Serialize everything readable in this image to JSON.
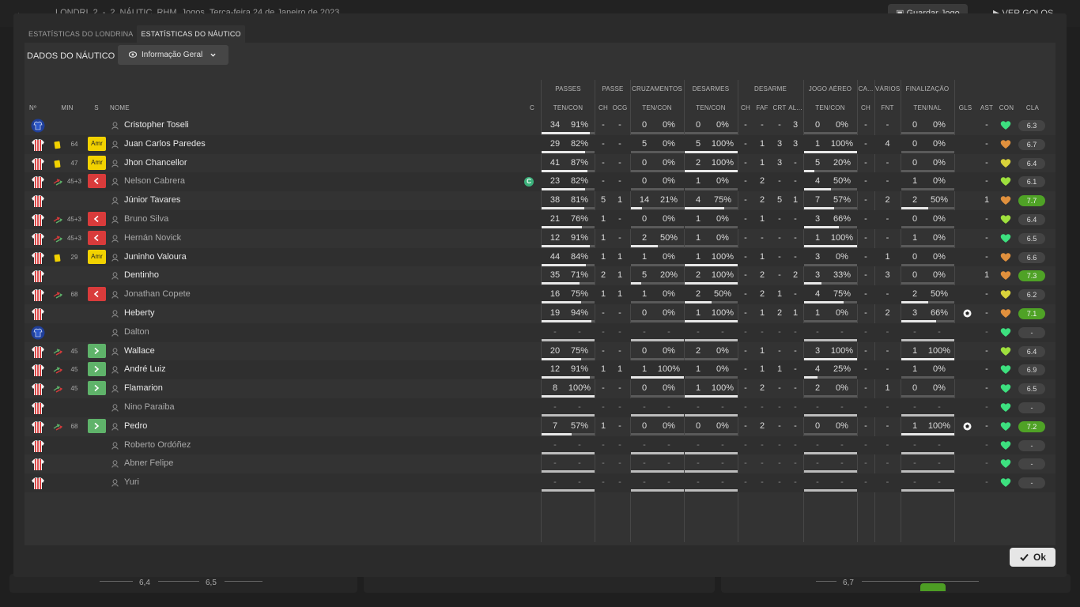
{
  "background": {
    "match_title": [
      "LONDRI",
      "2",
      "-",
      "2",
      "NÁUTIC",
      "RHM",
      "Jogos",
      "Terça-feira 24 de Janeiro de 2023"
    ],
    "save_button": "Guardar Jogo",
    "goals_button": "VER GOLOS",
    "ratings_left": [
      "6,4",
      "6,5"
    ],
    "rating_right": "6,7"
  },
  "tabs": [
    {
      "label": "ESTATÍSTICAS DO LONDRINA",
      "active": false
    },
    {
      "label": "ESTATÍSTICAS DO NÁUTICO",
      "active": true
    }
  ],
  "section_title": "DADOS DO NÁUTICO",
  "view_dropdown": "Informação Geral",
  "ok_label": "Ok",
  "group_headers": {
    "passes": "PASSES",
    "passe": "PASSE",
    "cruzamentos": "CRUZAMENTOS",
    "desarmes": "DESARMES",
    "desarme": "DESARME",
    "jogo_aereo": "JOGO AÉREO",
    "ca": "CA...",
    "varios": "VÁRIOS",
    "finalizacao": "FINALIZAÇÃO"
  },
  "columns": {
    "num": "Nº",
    "min": "MIN",
    "s": "S",
    "nome": "NOME",
    "c": "C",
    "passes": "TEN/CON",
    "ch1": "CH",
    "ocg": "OCG",
    "cruz": "TEN/CON",
    "des": "TEN/CON",
    "ch2": "CH",
    "faf": "FAF",
    "crt": "CRT",
    "al": "AL...",
    "aereo": "TEN/CON",
    "ch3": "CH",
    "fnt": "FNT",
    "fin": "TEN/NAL",
    "gls": "GLS",
    "ast": "AST",
    "con": "CON",
    "cla": "CLA"
  },
  "colors": {
    "rating_high": "#4fa226",
    "yellow_card": "#f2d200",
    "sub_out": "#d93b3b",
    "sub_in": "#5fb36a",
    "heart_green": "#3de07f",
    "heart_orange": "#e0903d",
    "heart_yellow": "#d9d23a",
    "heart_lime": "#9ee03d"
  },
  "players": [
    {
      "kit": "gk",
      "card": "",
      "min": "",
      "badge": "",
      "name": "Cristopher Toseli",
      "sub": false,
      "captain": false,
      "pas": [
        "34",
        "91%"
      ],
      "pas_pct": 0.91,
      "pch": "-",
      "ocg": "-",
      "cru": [
        "0",
        "0%"
      ],
      "cru_pct": 0,
      "des": [
        "0",
        "0%"
      ],
      "des_pct": 0,
      "dch": "-",
      "faf": "-",
      "crt": "-",
      "al": "3",
      "aer": [
        "0",
        "0%"
      ],
      "aer_pct": 0,
      "ach": "-",
      "fnt": "-",
      "fin": [
        "0",
        "0%"
      ],
      "fin_pct": 0,
      "gls": "",
      "ast": "-",
      "heart": "green",
      "cla": "6.3",
      "hi": false
    },
    {
      "kit": "st",
      "card": "y",
      "min": "64",
      "badge": "Amr",
      "name": "Juan Carlos Paredes",
      "sub": false,
      "captain": false,
      "pas": [
        "29",
        "82%"
      ],
      "pas_pct": 0.82,
      "pch": "-",
      "ocg": "-",
      "cru": [
        "5",
        "0%"
      ],
      "cru_pct": 0,
      "des": [
        "5",
        "100%"
      ],
      "des_pct": 1,
      "dch": "-",
      "faf": "1",
      "crt": "3",
      "al": "3",
      "aer": [
        "1",
        "100%"
      ],
      "aer_pct": 1,
      "ach": "-",
      "fnt": "4",
      "fin": [
        "0",
        "0%"
      ],
      "fin_pct": 0,
      "gls": "",
      "ast": "-",
      "heart": "orange",
      "cla": "6.7",
      "hi": false
    },
    {
      "kit": "st",
      "card": "y",
      "min": "47",
      "badge": "Amr",
      "name": "Jhon Chancellor",
      "sub": false,
      "captain": false,
      "pas": [
        "41",
        "87%"
      ],
      "pas_pct": 0.87,
      "pch": "-",
      "ocg": "-",
      "cru": [
        "0",
        "0%"
      ],
      "cru_pct": 0,
      "des": [
        "2",
        "100%"
      ],
      "des_pct": 1,
      "dch": "-",
      "faf": "1",
      "crt": "3",
      "al": "-",
      "aer": [
        "5",
        "20%"
      ],
      "aer_pct": 0.2,
      "ach": "-",
      "fnt": "-",
      "fin": [
        "0",
        "0%"
      ],
      "fin_pct": 0,
      "gls": "",
      "ast": "-",
      "heart": "yellow",
      "cla": "6.4",
      "hi": false
    },
    {
      "kit": "st",
      "card": "s",
      "min": "45+3",
      "badge": "out",
      "name": "Nelson Cabrera",
      "sub": true,
      "captain": true,
      "pas": [
        "23",
        "82%"
      ],
      "pas_pct": 0.82,
      "pch": "-",
      "ocg": "-",
      "cru": [
        "0",
        "0%"
      ],
      "cru_pct": 0,
      "des": [
        "1",
        "0%"
      ],
      "des_pct": 0,
      "dch": "-",
      "faf": "2",
      "crt": "-",
      "al": "-",
      "aer": [
        "4",
        "50%"
      ],
      "aer_pct": 0.5,
      "ach": "-",
      "fnt": "-",
      "fin": [
        "1",
        "0%"
      ],
      "fin_pct": 0,
      "gls": "",
      "ast": "-",
      "heart": "lime",
      "cla": "6.1",
      "hi": false
    },
    {
      "kit": "st",
      "card": "",
      "min": "",
      "badge": "",
      "name": "Júnior Tavares",
      "sub": false,
      "captain": false,
      "pas": [
        "38",
        "81%"
      ],
      "pas_pct": 0.81,
      "pch": "5",
      "ocg": "1",
      "cru": [
        "14",
        "21%"
      ],
      "cru_pct": 0.21,
      "des": [
        "4",
        "75%"
      ],
      "des_pct": 0.75,
      "dch": "-",
      "faf": "2",
      "crt": "5",
      "al": "1",
      "aer": [
        "7",
        "57%"
      ],
      "aer_pct": 0.57,
      "ach": "-",
      "fnt": "2",
      "fin": [
        "2",
        "50%"
      ],
      "fin_pct": 0.5,
      "gls": "",
      "ast": "1",
      "heart": "orange",
      "cla": "7.7",
      "hi": true
    },
    {
      "kit": "st",
      "card": "s",
      "min": "45+3",
      "badge": "out",
      "name": "Bruno Silva",
      "sub": true,
      "captain": false,
      "pas": [
        "21",
        "76%"
      ],
      "pas_pct": 0.76,
      "pch": "1",
      "ocg": "-",
      "cru": [
        "0",
        "0%"
      ],
      "cru_pct": 0,
      "des": [
        "1",
        "0%"
      ],
      "des_pct": 0,
      "dch": "-",
      "faf": "1",
      "crt": "-",
      "al": "-",
      "aer": [
        "3",
        "66%"
      ],
      "aer_pct": 0.66,
      "ach": "-",
      "fnt": "-",
      "fin": [
        "0",
        "0%"
      ],
      "fin_pct": 0,
      "gls": "",
      "ast": "-",
      "heart": "lime",
      "cla": "6.4",
      "hi": false
    },
    {
      "kit": "st",
      "card": "s",
      "min": "45+3",
      "badge": "out",
      "name": "Hernán Novick",
      "sub": true,
      "captain": false,
      "pas": [
        "12",
        "91%"
      ],
      "pas_pct": 0.91,
      "pch": "1",
      "ocg": "-",
      "cru": [
        "2",
        "50%"
      ],
      "cru_pct": 0.5,
      "des": [
        "1",
        "0%"
      ],
      "des_pct": 0,
      "dch": "-",
      "faf": "-",
      "crt": "-",
      "al": "-",
      "aer": [
        "1",
        "100%"
      ],
      "aer_pct": 1,
      "ach": "-",
      "fnt": "-",
      "fin": [
        "1",
        "0%"
      ],
      "fin_pct": 0,
      "gls": "",
      "ast": "-",
      "heart": "green",
      "cla": "6.5",
      "hi": false
    },
    {
      "kit": "st",
      "card": "y",
      "min": "29",
      "badge": "Amr",
      "name": "Juninho Valoura",
      "sub": false,
      "captain": false,
      "pas": [
        "44",
        "84%"
      ],
      "pas_pct": 0.84,
      "pch": "1",
      "ocg": "1",
      "cru": [
        "1",
        "0%"
      ],
      "cru_pct": 0,
      "des": [
        "1",
        "100%"
      ],
      "des_pct": 1,
      "dch": "-",
      "faf": "1",
      "crt": "-",
      "al": "-",
      "aer": [
        "3",
        "0%"
      ],
      "aer_pct": 0,
      "ach": "-",
      "fnt": "1",
      "fin": [
        "0",
        "0%"
      ],
      "fin_pct": 0,
      "gls": "",
      "ast": "-",
      "heart": "orange",
      "cla": "6.6",
      "hi": false
    },
    {
      "kit": "st",
      "card": "",
      "min": "",
      "badge": "",
      "name": "Dentinho",
      "sub": false,
      "captain": false,
      "pas": [
        "35",
        "71%"
      ],
      "pas_pct": 0.71,
      "pch": "2",
      "ocg": "1",
      "cru": [
        "5",
        "20%"
      ],
      "cru_pct": 0.2,
      "des": [
        "2",
        "100%"
      ],
      "des_pct": 1,
      "dch": "-",
      "faf": "2",
      "crt": "-",
      "al": "2",
      "aer": [
        "3",
        "33%"
      ],
      "aer_pct": 0.33,
      "ach": "-",
      "fnt": "3",
      "fin": [
        "0",
        "0%"
      ],
      "fin_pct": 0,
      "gls": "",
      "ast": "1",
      "heart": "orange",
      "cla": "7.3",
      "hi": true
    },
    {
      "kit": "st",
      "card": "s",
      "min": "68",
      "badge": "out",
      "name": "Jonathan Copete",
      "sub": true,
      "captain": false,
      "pas": [
        "16",
        "75%"
      ],
      "pas_pct": 0.75,
      "pch": "1",
      "ocg": "1",
      "cru": [
        "1",
        "0%"
      ],
      "cru_pct": 0,
      "des": [
        "2",
        "50%"
      ],
      "des_pct": 0.5,
      "dch": "-",
      "faf": "2",
      "crt": "1",
      "al": "-",
      "aer": [
        "4",
        "75%"
      ],
      "aer_pct": 0.75,
      "ach": "-",
      "fnt": "-",
      "fin": [
        "2",
        "50%"
      ],
      "fin_pct": 0.5,
      "gls": "",
      "ast": "-",
      "heart": "yellow",
      "cla": "6.2",
      "hi": false
    },
    {
      "kit": "st",
      "card": "",
      "min": "",
      "badge": "",
      "name": "Heberty",
      "sub": false,
      "captain": false,
      "pas": [
        "19",
        "94%"
      ],
      "pas_pct": 0.94,
      "pch": "-",
      "ocg": "-",
      "cru": [
        "0",
        "0%"
      ],
      "cru_pct": 0,
      "des": [
        "1",
        "100%"
      ],
      "des_pct": 1,
      "dch": "-",
      "faf": "1",
      "crt": "2",
      "al": "1",
      "aer": [
        "1",
        "0%"
      ],
      "aer_pct": 0,
      "ach": "-",
      "fnt": "2",
      "fin": [
        "3",
        "66%"
      ],
      "fin_pct": 0.66,
      "gls": "ball",
      "ast": "-",
      "heart": "orange",
      "cla": "7.1",
      "hi": true
    },
    {
      "kit": "gk",
      "card": "",
      "min": "",
      "badge": "",
      "name": "Dalton",
      "sub": true,
      "captain": false,
      "pas": [
        "-",
        "-"
      ],
      "pas_pct": 1,
      "pch": "-",
      "ocg": "-",
      "cru": [
        "-",
        "-"
      ],
      "cru_pct": 1,
      "des": [
        "-",
        "-"
      ],
      "des_pct": 1,
      "dch": "-",
      "faf": "-",
      "crt": "-",
      "al": "-",
      "aer": [
        "-",
        "-"
      ],
      "aer_pct": 1,
      "ach": "-",
      "fnt": "-",
      "fin": [
        "-",
        "-"
      ],
      "fin_pct": 1,
      "gls": "",
      "ast": "-",
      "heart": "green",
      "cla": "-",
      "hi": false
    },
    {
      "kit": "st",
      "card": "s",
      "min": "45",
      "badge": "in",
      "name": "Wallace",
      "sub": false,
      "captain": false,
      "pas": [
        "20",
        "75%"
      ],
      "pas_pct": 0.75,
      "pch": "-",
      "ocg": "-",
      "cru": [
        "0",
        "0%"
      ],
      "cru_pct": 0,
      "des": [
        "2",
        "0%"
      ],
      "des_pct": 0,
      "dch": "-",
      "faf": "1",
      "crt": "-",
      "al": "-",
      "aer": [
        "3",
        "100%"
      ],
      "aer_pct": 1,
      "ach": "-",
      "fnt": "-",
      "fin": [
        "1",
        "100%"
      ],
      "fin_pct": 1,
      "gls": "",
      "ast": "-",
      "heart": "lime",
      "cla": "6.4",
      "hi": false
    },
    {
      "kit": "st",
      "card": "s",
      "min": "45",
      "badge": "in",
      "name": "André Luiz",
      "sub": false,
      "captain": false,
      "pas": [
        "12",
        "91%"
      ],
      "pas_pct": 0.91,
      "pch": "1",
      "ocg": "1",
      "cru": [
        "1",
        "100%"
      ],
      "cru_pct": 1,
      "des": [
        "1",
        "0%"
      ],
      "des_pct": 0,
      "dch": "-",
      "faf": "1",
      "crt": "1",
      "al": "-",
      "aer": [
        "4",
        "25%"
      ],
      "aer_pct": 0.25,
      "ach": "-",
      "fnt": "-",
      "fin": [
        "1",
        "0%"
      ],
      "fin_pct": 0,
      "gls": "",
      "ast": "-",
      "heart": "green",
      "cla": "6.9",
      "hi": false
    },
    {
      "kit": "st",
      "card": "s",
      "min": "45",
      "badge": "in",
      "name": "Flamarion",
      "sub": false,
      "captain": false,
      "pas": [
        "8",
        "100%"
      ],
      "pas_pct": 1,
      "pch": "-",
      "ocg": "-",
      "cru": [
        "0",
        "0%"
      ],
      "cru_pct": 0,
      "des": [
        "1",
        "100%"
      ],
      "des_pct": 1,
      "dch": "-",
      "faf": "2",
      "crt": "-",
      "al": "-",
      "aer": [
        "2",
        "0%"
      ],
      "aer_pct": 0,
      "ach": "-",
      "fnt": "1",
      "fin": [
        "0",
        "0%"
      ],
      "fin_pct": 0,
      "gls": "",
      "ast": "-",
      "heart": "green",
      "cla": "6.5",
      "hi": false
    },
    {
      "kit": "st",
      "card": "",
      "min": "",
      "badge": "",
      "name": "Nino Paraiba",
      "sub": true,
      "captain": false,
      "pas": [
        "-",
        "-"
      ],
      "pas_pct": 1,
      "pch": "-",
      "ocg": "-",
      "cru": [
        "-",
        "-"
      ],
      "cru_pct": 1,
      "des": [
        "-",
        "-"
      ],
      "des_pct": 1,
      "dch": "-",
      "faf": "-",
      "crt": "-",
      "al": "-",
      "aer": [
        "-",
        "-"
      ],
      "aer_pct": 1,
      "ach": "-",
      "fnt": "-",
      "fin": [
        "-",
        "-"
      ],
      "fin_pct": 1,
      "gls": "",
      "ast": "-",
      "heart": "green",
      "cla": "-",
      "hi": false
    },
    {
      "kit": "st",
      "card": "s",
      "min": "68",
      "badge": "in",
      "name": "Pedro",
      "sub": false,
      "captain": false,
      "pas": [
        "7",
        "57%"
      ],
      "pas_pct": 0.57,
      "pch": "1",
      "ocg": "-",
      "cru": [
        "0",
        "0%"
      ],
      "cru_pct": 0,
      "des": [
        "0",
        "0%"
      ],
      "des_pct": 0,
      "dch": "-",
      "faf": "2",
      "crt": "-",
      "al": "-",
      "aer": [
        "0",
        "0%"
      ],
      "aer_pct": 0,
      "ach": "-",
      "fnt": "-",
      "fin": [
        "1",
        "100%"
      ],
      "fin_pct": 1,
      "gls": "ball",
      "ast": "-",
      "heart": "green",
      "cla": "7.2",
      "hi": true
    },
    {
      "kit": "st",
      "card": "",
      "min": "",
      "badge": "",
      "name": "Roberto Ordóñez",
      "sub": true,
      "captain": false,
      "pas": [
        "-",
        "-"
      ],
      "pas_pct": 1,
      "pch": "-",
      "ocg": "-",
      "cru": [
        "-",
        "-"
      ],
      "cru_pct": 1,
      "des": [
        "-",
        "-"
      ],
      "des_pct": 1,
      "dch": "-",
      "faf": "-",
      "crt": "-",
      "al": "-",
      "aer": [
        "-",
        "-"
      ],
      "aer_pct": 1,
      "ach": "-",
      "fnt": "-",
      "fin": [
        "-",
        "-"
      ],
      "fin_pct": 1,
      "gls": "",
      "ast": "-",
      "heart": "green",
      "cla": "-",
      "hi": false
    },
    {
      "kit": "st",
      "card": "",
      "min": "",
      "badge": "",
      "name": "Abner Felipe",
      "sub": true,
      "captain": false,
      "pas": [
        "-",
        "-"
      ],
      "pas_pct": 1,
      "pch": "-",
      "ocg": "-",
      "cru": [
        "-",
        "-"
      ],
      "cru_pct": 1,
      "des": [
        "-",
        "-"
      ],
      "des_pct": 1,
      "dch": "-",
      "faf": "-",
      "crt": "-",
      "al": "-",
      "aer": [
        "-",
        "-"
      ],
      "aer_pct": 1,
      "ach": "-",
      "fnt": "-",
      "fin": [
        "-",
        "-"
      ],
      "fin_pct": 1,
      "gls": "",
      "ast": "-",
      "heart": "green",
      "cla": "-",
      "hi": false
    },
    {
      "kit": "st",
      "card": "",
      "min": "",
      "badge": "",
      "name": "Yuri",
      "sub": true,
      "captain": false,
      "pas": [
        "-",
        "-"
      ],
      "pas_pct": 1,
      "pch": "-",
      "ocg": "-",
      "cru": [
        "-",
        "-"
      ],
      "cru_pct": 1,
      "des": [
        "-",
        "-"
      ],
      "des_pct": 1,
      "dch": "-",
      "faf": "-",
      "crt": "-",
      "al": "-",
      "aer": [
        "-",
        "-"
      ],
      "aer_pct": 1,
      "ach": "-",
      "fnt": "-",
      "fin": [
        "-",
        "-"
      ],
      "fin_pct": 1,
      "gls": "",
      "ast": "-",
      "heart": "green",
      "cla": "-",
      "hi": false
    }
  ]
}
